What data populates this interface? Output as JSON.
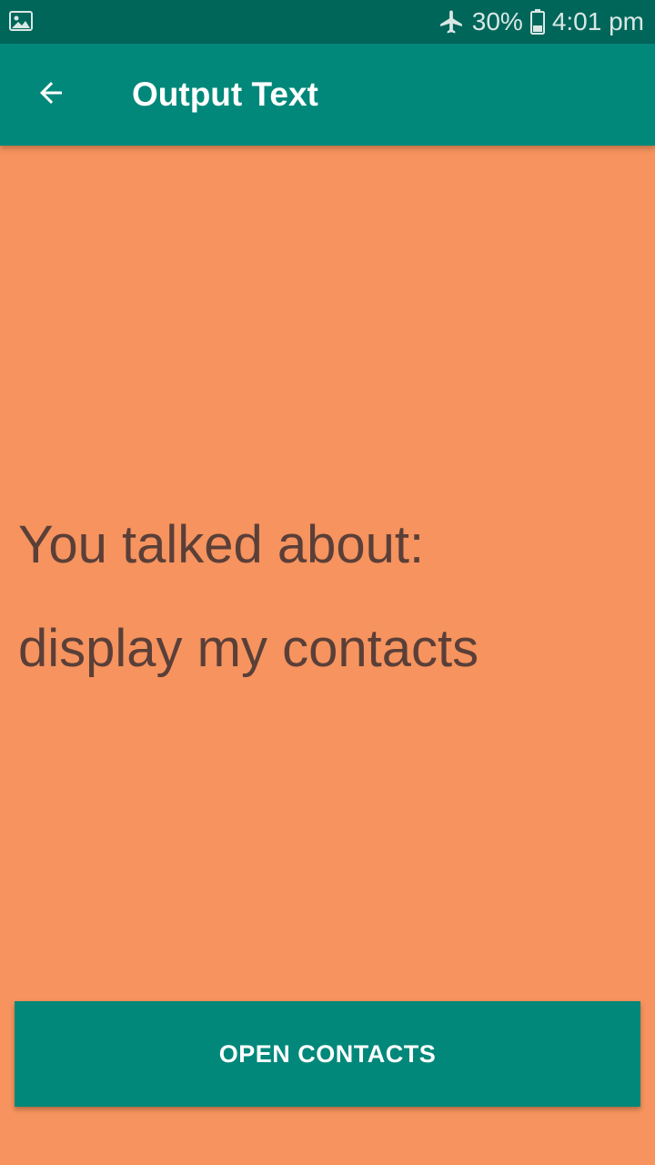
{
  "status_bar": {
    "left_icon": "image-notification-icon",
    "airplane_icon": "airplane-mode-icon",
    "battery_percent": "30%",
    "battery_icon": "battery-icon",
    "time": "4:01 pm"
  },
  "app_bar": {
    "back_icon": "arrow-back-icon",
    "title": "Output Text"
  },
  "content": {
    "heading": "You talked about:",
    "spoken_text": "display my contacts"
  },
  "actions": {
    "open_contacts_label": "OPEN CONTACTS"
  },
  "colors": {
    "status_bar": "#00665A",
    "app_bar": "#02887A",
    "background": "#F6935E",
    "text": "#5A3F38",
    "button": "#02887A"
  }
}
